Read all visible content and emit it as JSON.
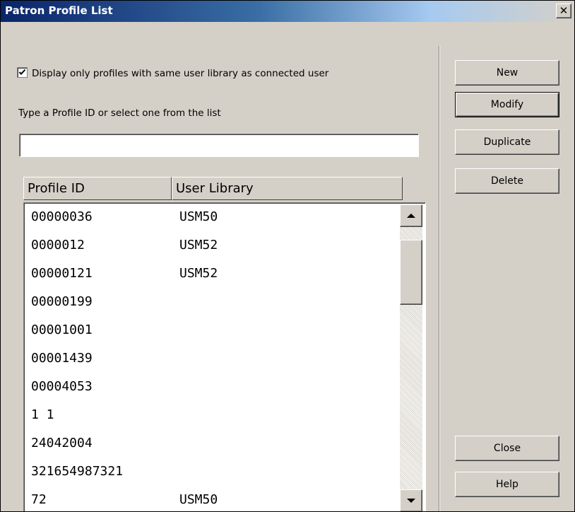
{
  "window": {
    "title": "Patron Profile List",
    "close_glyph": "✕"
  },
  "filter": {
    "checked": true,
    "label": "Display only profiles with same user library as connected user"
  },
  "search": {
    "prompt": "Type a Profile ID or select one from the list",
    "value": "",
    "placeholder": ""
  },
  "list": {
    "columns": [
      "Profile ID",
      "User Library"
    ],
    "rows": [
      {
        "id": "00000036",
        "library": "USM50"
      },
      {
        "id": "0000012",
        "library": "USM52"
      },
      {
        "id": "00000121",
        "library": "USM52"
      },
      {
        "id": "00000199",
        "library": ""
      },
      {
        "id": "00001001",
        "library": ""
      },
      {
        "id": "00001439",
        "library": ""
      },
      {
        "id": "00004053",
        "library": ""
      },
      {
        "id": "1 1",
        "library": ""
      },
      {
        "id": "24042004",
        "library": ""
      },
      {
        "id": "321654987321",
        "library": ""
      },
      {
        "id": "72",
        "library": "USM50"
      }
    ]
  },
  "buttons": {
    "new": "New",
    "modify": "Modify",
    "duplicate": "Duplicate",
    "delete": "Delete",
    "close": "Close",
    "help": "Help"
  },
  "icons": {
    "scroll_up": "scroll-up-arrow-icon",
    "scroll_down": "scroll-down-arrow-icon",
    "close": "close-icon",
    "check": "checkmark-icon"
  },
  "colors": {
    "title_gradient_start": "#0a246a",
    "title_gradient_end": "#a6caf0",
    "face": "#d4d0c8"
  }
}
